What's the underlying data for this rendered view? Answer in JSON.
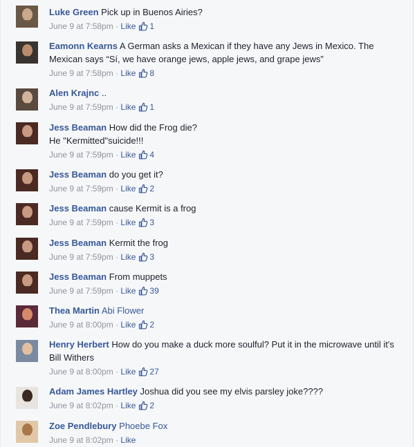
{
  "comments": [
    {
      "author": "Luke Green",
      "tag": "",
      "text": "Pick up in Buenos Airies?",
      "time": "June 9 at 7:58pm",
      "like": "Like",
      "likes": "1",
      "avatar_colors": [
        "#6a5848",
        "#c9a98a"
      ]
    },
    {
      "author": "Eamonn Kearns",
      "tag": "",
      "text": "A German asks a Mexican if they have any Jews in Mexico. The Mexican says “Sí, we have orange jews, apple jews, and grape jews”",
      "time": "June 9 at 7:58pm",
      "like": "Like",
      "likes": "8",
      "avatar_colors": [
        "#3a3430",
        "#b88c6c"
      ]
    },
    {
      "author": "Alen Krajnc",
      "tag": "",
      "text": "..",
      "time": "June 9 at 7:59pm",
      "like": "Like",
      "likes": "1",
      "avatar_colors": [
        "#5a4a40",
        "#d2b49a"
      ]
    },
    {
      "author": "Jess Beaman",
      "tag": "",
      "text": "How did the Frog die?\nHe \"Kermitted\"suicide!!!",
      "time": "June 9 at 7:59pm",
      "like": "Like",
      "likes": "4",
      "avatar_colors": [
        "#4a2a22",
        "#c89a82"
      ]
    },
    {
      "author": "Jess Beaman",
      "tag": "",
      "text": "do you get it?",
      "time": "June 9 at 7:59pm",
      "like": "Like",
      "likes": "2",
      "avatar_colors": [
        "#4a2a22",
        "#c89a82"
      ]
    },
    {
      "author": "Jess Beaman",
      "tag": "",
      "text": "cause Kermit is a frog",
      "time": "June 9 at 7:59pm",
      "like": "Like",
      "likes": "3",
      "avatar_colors": [
        "#4a2a22",
        "#c89a82"
      ]
    },
    {
      "author": "Jess Beaman",
      "tag": "",
      "text": "Kermit the frog",
      "time": "June 9 at 7:59pm",
      "like": "Like",
      "likes": "3",
      "avatar_colors": [
        "#4a2a22",
        "#c89a82"
      ]
    },
    {
      "author": "Jess Beaman",
      "tag": "",
      "text": "From muppets",
      "time": "June 9 at 7:59pm",
      "like": "Like",
      "likes": "39",
      "avatar_colors": [
        "#4a2a22",
        "#c89a82"
      ]
    },
    {
      "author": "Thea Martin",
      "tag": "Abi Flower",
      "text": "",
      "time": "June 9 at 8:00pm",
      "like": "Like",
      "likes": "2",
      "avatar_colors": [
        "#5a2a3a",
        "#d48a6a"
      ]
    },
    {
      "author": "Henry Herbert",
      "tag": "",
      "text": "How do you make a duck more soulful? Put it in the microwave until it's Bill Withers",
      "time": "June 9 at 8:00pm",
      "like": "Like",
      "likes": "27",
      "avatar_colors": [
        "#7a8aa0",
        "#e0c0a0"
      ]
    },
    {
      "author": "Adam James Hartley",
      "tag": "",
      "text": "Joshua did you see my elvis parsley joke????",
      "time": "June 9 at 8:02pm",
      "like": "Like",
      "likes": "2",
      "avatar_colors": [
        "#e8e4e0",
        "#3a2a22"
      ]
    },
    {
      "author": "Zoe Pendlebury",
      "tag": "Phoebe Fox",
      "text": "",
      "time": "June 9 at 8:02pm",
      "like": "Like",
      "likes": "",
      "avatar_colors": [
        "#e0c8a8",
        "#a8784a"
      ]
    }
  ],
  "separator": " · ",
  "colors": {
    "link": "#365899",
    "meta": "#90949c",
    "text": "#1d2129",
    "background": "#f6f7f9"
  },
  "icons": {
    "like": "thumbs-up-icon"
  }
}
